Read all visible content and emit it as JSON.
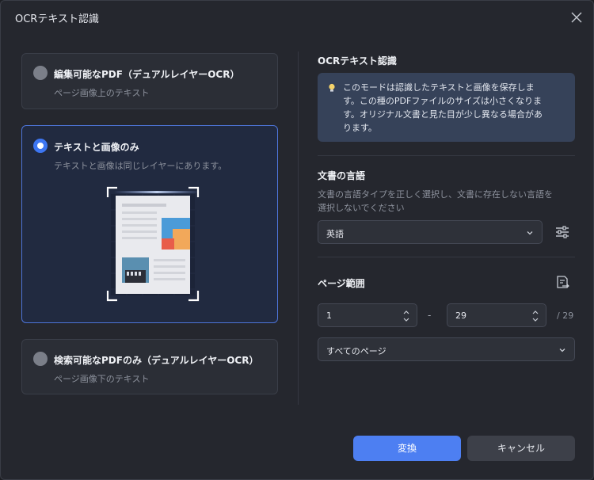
{
  "window": {
    "title": "OCRテキスト認識"
  },
  "options": [
    {
      "title": "編集可能なPDF（デュアルレイヤーOCR）",
      "subtitle": "ページ画像上のテキスト",
      "selected": false
    },
    {
      "title": "テキストと画像のみ",
      "subtitle": "テキストと画像は同じレイヤーにあります。",
      "selected": true
    },
    {
      "title": "検索可能なPDFのみ（デュアルレイヤーOCR）",
      "subtitle": "ページ画像下のテキスト",
      "selected": false
    }
  ],
  "ocr_section": {
    "title": "OCRテキスト認識",
    "info_lines": [
      "このモードは認識したテキストと画像を保存しま",
      "す。この種のPDFファイルのサイズは小さくなりま",
      "す。オリジナル文書と見た目が少し異なる場合があ",
      "ります。"
    ]
  },
  "language_section": {
    "title": "文書の言語",
    "desc_lines": [
      "文書の言語タイプを正しく選択し、文書に存在しない言語を",
      "選択しないでください"
    ],
    "selected": "英語"
  },
  "page_range": {
    "title": "ページ範囲",
    "from": "1",
    "separator": "-",
    "to": "29",
    "total": "/ 29",
    "mode": "すべてのページ"
  },
  "buttons": {
    "convert": "変換",
    "cancel": "キャンセル"
  },
  "colors": {
    "accent": "#4d7ff2",
    "selected_border": "#4d74d8",
    "background": "#25272e"
  },
  "icons": [
    "close-icon",
    "lightbulb-icon",
    "chevron-down-icon",
    "settings-sliders-icon",
    "page-range-icon",
    "stepper-arrows-icon"
  ]
}
